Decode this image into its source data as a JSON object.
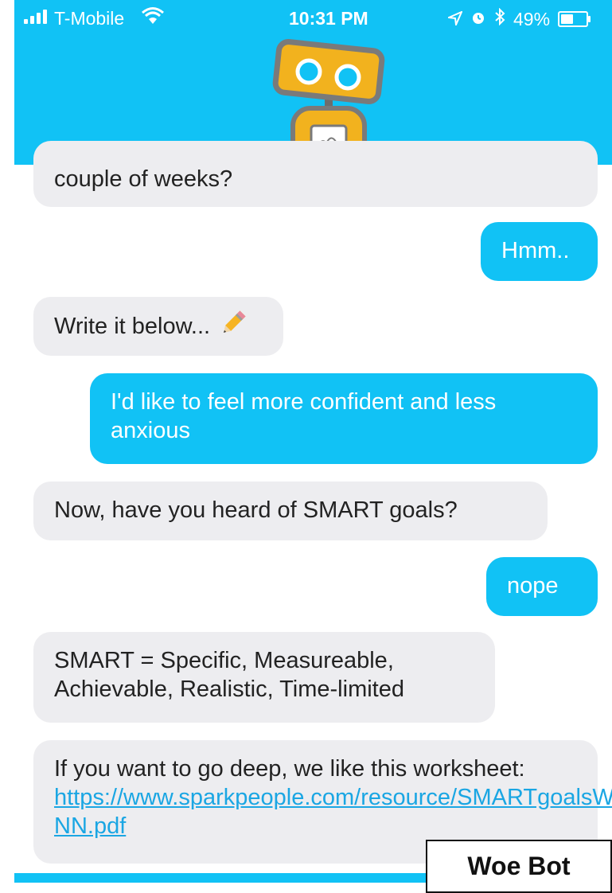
{
  "status_bar": {
    "carrier": "T-Mobile",
    "time": "10:31 PM",
    "battery": "49%",
    "battery_fraction": 0.49
  },
  "messages": [
    {
      "sender": "bot",
      "text": "couple of weeks?"
    },
    {
      "sender": "user",
      "text": "Hmm.."
    },
    {
      "sender": "bot",
      "text": "Write it below...",
      "emoji": "pencil"
    },
    {
      "sender": "user",
      "text": "I'd like to feel more confident and less anxious"
    },
    {
      "sender": "bot",
      "text": "Now, have you heard of SMART goals?"
    },
    {
      "sender": "user",
      "text": "nope"
    },
    {
      "sender": "bot",
      "text": "SMART = Specific, Measureable, Achievable, Realistic, Time-limited"
    },
    {
      "sender": "bot",
      "text": "If you want to go deep, we like this worksheet: ",
      "link": "https://www.sparkpeople.com/resource/SMARTgoalsWS-NN.pdf"
    }
  ],
  "caption": "Woe Bot",
  "colors": {
    "brand": "#11c2f5",
    "bot_bubble": "#ededf0",
    "link": "#1aa6e3"
  }
}
